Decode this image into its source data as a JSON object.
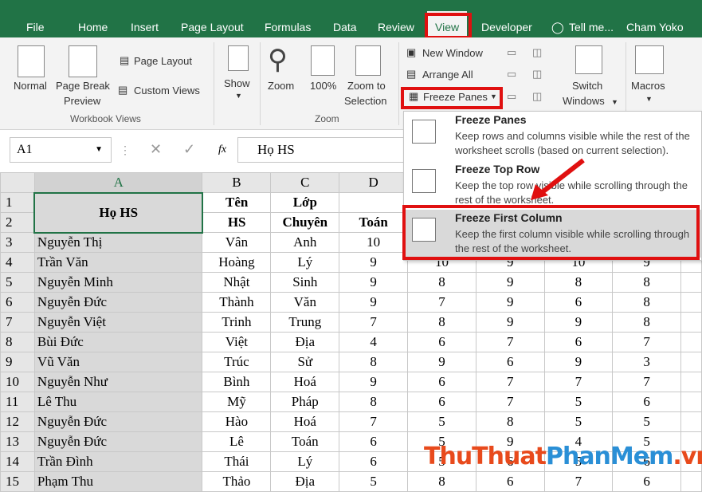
{
  "tabs": [
    "File",
    "Home",
    "Insert",
    "Page Layout",
    "Formulas",
    "Data",
    "Review",
    "View",
    "Developer",
    "Tell me...",
    "Cham Yoko"
  ],
  "ribbon": {
    "normal": "Normal",
    "page_break": "Page Break",
    "preview": "Preview",
    "page_layout": "Page Layout",
    "custom_views": "Custom Views",
    "workbook_views": "Workbook Views",
    "show": "Show",
    "zoom": "Zoom",
    "zoom100": "100%",
    "zoom_to": "Zoom to",
    "selection": "Selection",
    "zoom_group": "Zoom",
    "new_window": "New Window",
    "arrange_all": "Arrange All",
    "freeze_panes": "Freeze Panes",
    "switch": "Switch",
    "windows": "Windows",
    "macros": "Macros"
  },
  "formula_bar": {
    "cell": "A1",
    "fx": "fx",
    "value": "Họ HS"
  },
  "menu": {
    "items": [
      {
        "title": "Freeze Panes",
        "desc": "Keep rows and columns visible while the rest of the worksheet scrolls (based on current selection)."
      },
      {
        "title": "Freeze Top Row",
        "desc": "Keep the top row visible while scrolling through the rest of the worksheet."
      },
      {
        "title": "Freeze First Column",
        "desc": "Keep the first column visible while scrolling through the rest of the worksheet."
      }
    ]
  },
  "columns": [
    "A",
    "B",
    "C",
    "D"
  ],
  "header": {
    "a": "Họ HS",
    "b1": "Tên",
    "b2": "HS",
    "c1": "Lớp",
    "c2": "Chuyên",
    "d2": "Toán"
  },
  "rows": [
    {
      "n": "3",
      "a": "Nguyễn Thị",
      "b": "Vân",
      "c": "Anh",
      "d": "10",
      "e": "",
      "f": "",
      "g": "",
      "h": ""
    },
    {
      "n": "4",
      "a": "Trần Văn",
      "b": "Hoàng",
      "c": "Lý",
      "d": "9",
      "e": "10",
      "f": "9",
      "g": "10",
      "h": "9"
    },
    {
      "n": "5",
      "a": "Nguyễn Minh",
      "b": "Nhật",
      "c": "Sinh",
      "d": "9",
      "e": "8",
      "f": "9",
      "g": "8",
      "h": "8"
    },
    {
      "n": "6",
      "a": "Nguyễn Đức",
      "b": "Thành",
      "c": "Văn",
      "d": "9",
      "e": "7",
      "f": "9",
      "g": "6",
      "h": "8"
    },
    {
      "n": "7",
      "a": "Nguyễn Việt",
      "b": "Trinh",
      "c": "Trung",
      "d": "7",
      "e": "8",
      "f": "9",
      "g": "9",
      "h": "8"
    },
    {
      "n": "8",
      "a": "Bùi Đức",
      "b": "Việt",
      "c": "Địa",
      "d": "4",
      "e": "6",
      "f": "7",
      "g": "6",
      "h": "7"
    },
    {
      "n": "9",
      "a": "Vũ Văn",
      "b": "Trúc",
      "c": "Sử",
      "d": "8",
      "e": "9",
      "f": "6",
      "g": "9",
      "h": "3"
    },
    {
      "n": "10",
      "a": "Nguyễn Như",
      "b": "Bình",
      "c": "Hoá",
      "d": "9",
      "e": "6",
      "f": "7",
      "g": "7",
      "h": "7"
    },
    {
      "n": "11",
      "a": "Lê Thu",
      "b": "Mỹ",
      "c": "Pháp",
      "d": "8",
      "e": "6",
      "f": "7",
      "g": "5",
      "h": "6"
    },
    {
      "n": "12",
      "a": "Nguyễn Đức",
      "b": "Hào",
      "c": "Hoá",
      "d": "7",
      "e": "5",
      "f": "8",
      "g": "5",
      "h": "5"
    },
    {
      "n": "13",
      "a": "Nguyễn Đức",
      "b": "Lê",
      "c": "Toán",
      "d": "6",
      "e": "5",
      "f": "9",
      "g": "4",
      "h": "5"
    },
    {
      "n": "14",
      "a": "Trần Đình",
      "b": "Thái",
      "c": "Lý",
      "d": "6",
      "e": "5",
      "f": "6",
      "g": "5",
      "h": "6"
    },
    {
      "n": "15",
      "a": "Phạm Thu",
      "b": "Thảo",
      "c": "Địa",
      "d": "5",
      "e": "8",
      "f": "6",
      "g": "7",
      "h": "6"
    }
  ],
  "watermark": {
    "part1": "ThuThuat",
    "part2": "PhanMem",
    "part3": ".vn"
  }
}
